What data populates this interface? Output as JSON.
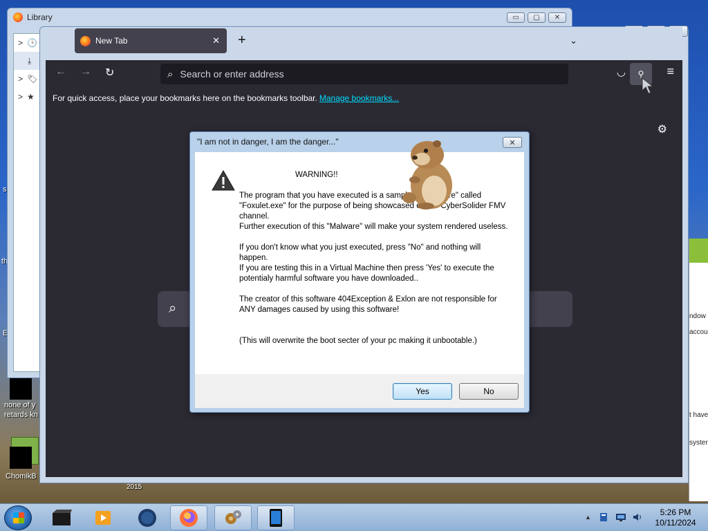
{
  "desktop": {
    "left_texts": [
      "s",
      "th",
      "E",
      "none of y",
      "retards kn",
      "ChomikB"
    ],
    "year_label": "2015",
    "right_fragments": [
      "ndow",
      "accoun",
      "t have",
      "syster"
    ]
  },
  "library_window": {
    "title": "Library",
    "sidebar": [
      {
        "icon": "clock-icon",
        "label": ">"
      },
      {
        "icon": "download-icon",
        "label": ""
      },
      {
        "icon": "tag-icon",
        "label": ">"
      },
      {
        "icon": "star-icon",
        "label": ">"
      }
    ],
    "controls": {
      "minimize": "▭",
      "maximize": "▢",
      "close": "✕"
    }
  },
  "browser": {
    "tab_title": "New Tab",
    "tab_close": "✕",
    "new_tab": "+",
    "list_tabs": "⌄",
    "controls": {
      "minimize": "▭",
      "maximize": "▢",
      "close": "✕"
    },
    "nav": {
      "back": "←",
      "forward": "→",
      "reload": "↻"
    },
    "urlbar_placeholder": "Search or enter address",
    "bookmarks_message": "For quick access, place your bookmarks here on the bookmarks toolbar.",
    "manage_bookmarks": "Manage bookmarks...",
    "settings_icon": "⚙",
    "menu_icon": "≡"
  },
  "dialog": {
    "title": "\"I am not in danger, I am the danger...\"",
    "close_label": "✕",
    "heading": "WARNING!!",
    "paragraphs": [
      "The program that you have executed is a sample of \"Malware\" called \"Foxulet.exe\" for the purpose of being showcased on the CyberSolider FMV channel.\nFurther execution of this \"Malware\" will make your system rendered useless.",
      "If you don't know what you just executed, press \"No\" and nothing will happen.\n If you are testing this in a Virtual Machine then press 'Yes' to execute the potentialy harmful software you have downloaded..",
      "The creator of this software 404Exception & Exlon are not responsible for ANY damages caused by using this software!",
      "(This will overwrite the boot secter of your pc making it unbootable.)"
    ],
    "yes_label": "Yes",
    "no_label": "No"
  },
  "taskbar": {
    "clock_time": "5:26 PM",
    "clock_date": "10/11/2024",
    "tray_arrow": "▲"
  }
}
